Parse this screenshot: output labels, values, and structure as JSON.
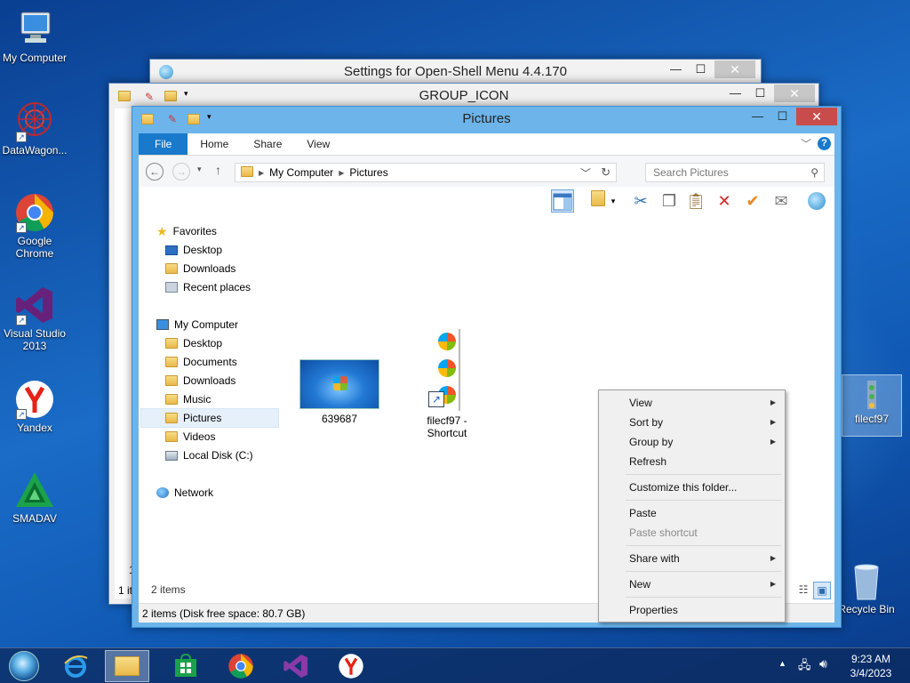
{
  "desktop": {
    "icons": [
      {
        "label": "My Computer"
      },
      {
        "label": "DataWagon..."
      },
      {
        "label": "Google Chrome"
      },
      {
        "label": "Visual Studio 2013"
      },
      {
        "label": "Yandex"
      },
      {
        "label": "SMADAV"
      },
      {
        "label": "filecf97"
      },
      {
        "label": "Recycle Bin"
      }
    ]
  },
  "back_window_1": {
    "title": "Settings for Open-Shell Menu 4.4.170"
  },
  "back_window_2": {
    "title": "GROUP_ICON",
    "status_fragment": "1 it",
    "side_fragment": "1"
  },
  "explorer": {
    "title": "Pictures",
    "ribbon_tabs": [
      "File",
      "Home",
      "Share",
      "View"
    ],
    "breadcrumb": [
      "My Computer",
      "Pictures"
    ],
    "search_placeholder": "Search Pictures",
    "nav": {
      "favorites": "Favorites",
      "favorites_items": [
        "Desktop",
        "Downloads",
        "Recent places"
      ],
      "computer": "My Computer",
      "computer_items": [
        "Desktop",
        "Documents",
        "Downloads",
        "Music",
        "Pictures",
        "Videos",
        "Local Disk (C:)"
      ],
      "network": "Network"
    },
    "files": [
      {
        "name": "639687"
      },
      {
        "name": "filecf97 - Shortcut"
      }
    ],
    "item_count": "2 items",
    "status": "2 items (Disk free space: 80.7 GB)"
  },
  "context_menu": {
    "items": [
      {
        "label": "View",
        "submenu": true
      },
      {
        "label": "Sort by",
        "submenu": true
      },
      {
        "label": "Group by",
        "submenu": true
      },
      {
        "label": "Refresh"
      },
      {
        "label": "Customize this folder..."
      },
      {
        "label": "Paste"
      },
      {
        "label": "Paste shortcut",
        "disabled": true
      },
      {
        "label": "Share with",
        "submenu": true
      },
      {
        "label": "New",
        "submenu": true
      },
      {
        "label": "Properties"
      }
    ]
  },
  "taskbar": {
    "time": "9:23 AM",
    "date": "3/4/2023"
  },
  "colors": {
    "accent": "#1979ca",
    "title_active": "#6cb4ea",
    "close": "#c94c4c"
  }
}
